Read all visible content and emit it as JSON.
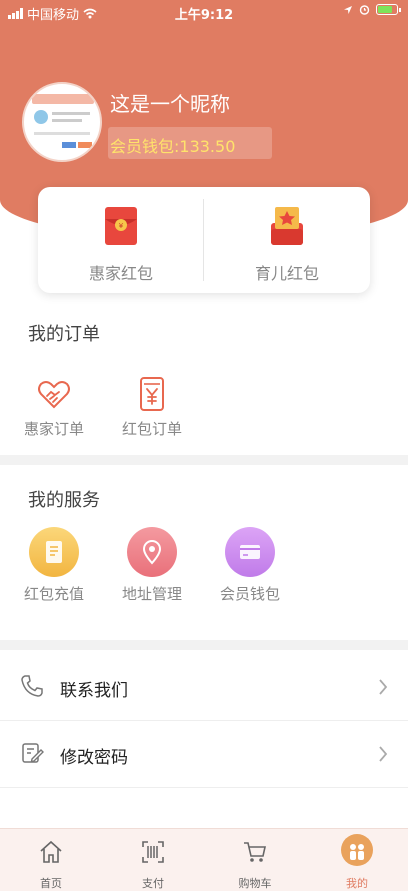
{
  "status_bar": {
    "carrier": "中国移动",
    "time": "上午9:12"
  },
  "profile": {
    "nickname": "这是一个昵称",
    "wallet_label": "会员钱包:133.50"
  },
  "red_packets": [
    {
      "label": "惠家红包",
      "icon": "red-envelope-icon"
    },
    {
      "label": "育儿红包",
      "icon": "gift-box-icon"
    }
  ],
  "orders": {
    "title": "我的订单",
    "items": [
      {
        "label": "惠家订单",
        "icon": "handshake-heart-icon"
      },
      {
        "label": "红包订单",
        "icon": "yen-envelope-icon"
      }
    ]
  },
  "services": {
    "title": "我的服务",
    "items": [
      {
        "label": "红包充值",
        "icon": "document-icon",
        "color": "#f6c15a"
      },
      {
        "label": "地址管理",
        "icon": "location-pin-icon",
        "color": "#ee7f86"
      },
      {
        "label": "会员钱包",
        "icon": "card-icon",
        "color": "#c889f0"
      }
    ]
  },
  "list": [
    {
      "label": "联系我们",
      "icon": "phone-icon"
    },
    {
      "label": "修改密码",
      "icon": "edit-icon"
    }
  ],
  "tabbar": [
    {
      "label": "首页",
      "icon": "home-icon"
    },
    {
      "label": "支付",
      "icon": "scan-icon"
    },
    {
      "label": "购物车",
      "icon": "cart-icon"
    },
    {
      "label": "我的",
      "icon": "profile-icon",
      "active": true
    }
  ],
  "colors": {
    "brand": "#e07c62",
    "wallet_text": "#ffe36b"
  }
}
